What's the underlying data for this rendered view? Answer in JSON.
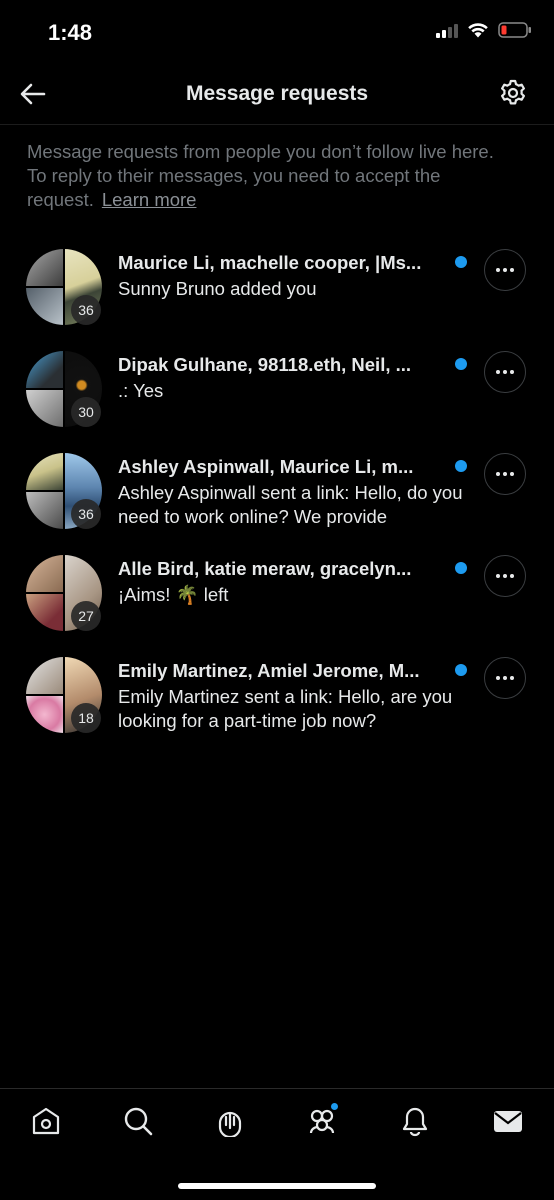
{
  "status_bar": {
    "time": "1:48"
  },
  "header": {
    "title": "Message requests"
  },
  "info": {
    "text": "Message requests from people you don’t follow live here. To reply to their messages, you need to accept the request.",
    "link": "Learn more"
  },
  "conversations": [
    {
      "names": "Maurice Li, machelle cooper, |Ms...",
      "preview": "Sunny Bruno added you",
      "count": "36"
    },
    {
      "names": "Dipak Gulhane, 98118.eth, Neil, ...",
      "preview": ".: Yes",
      "count": "30"
    },
    {
      "names": "Ashley Aspinwall, Maurice Li, m...",
      "preview": "Ashley Aspinwall sent a link: Hello, do you need to work online? We provide",
      "count": "36"
    },
    {
      "names": "Alle Bird, katie meraw, gracelyn...",
      "preview": "¡Aims! 🌴 left",
      "count": "27"
    },
    {
      "names": "Emily Martinez, Amiel Jerome, M...",
      "preview": "Emily Martinez sent a link: Hello, are you looking for a part-time job now?",
      "count": "18"
    }
  ],
  "colors": {
    "accent": "#1d9bf0",
    "background": "#000000",
    "secondary_text": "#71767b"
  },
  "nav": {
    "icons": [
      "home-icon",
      "search-icon",
      "spaces-icon",
      "communities-icon",
      "notifications-icon",
      "messages-icon"
    ]
  }
}
